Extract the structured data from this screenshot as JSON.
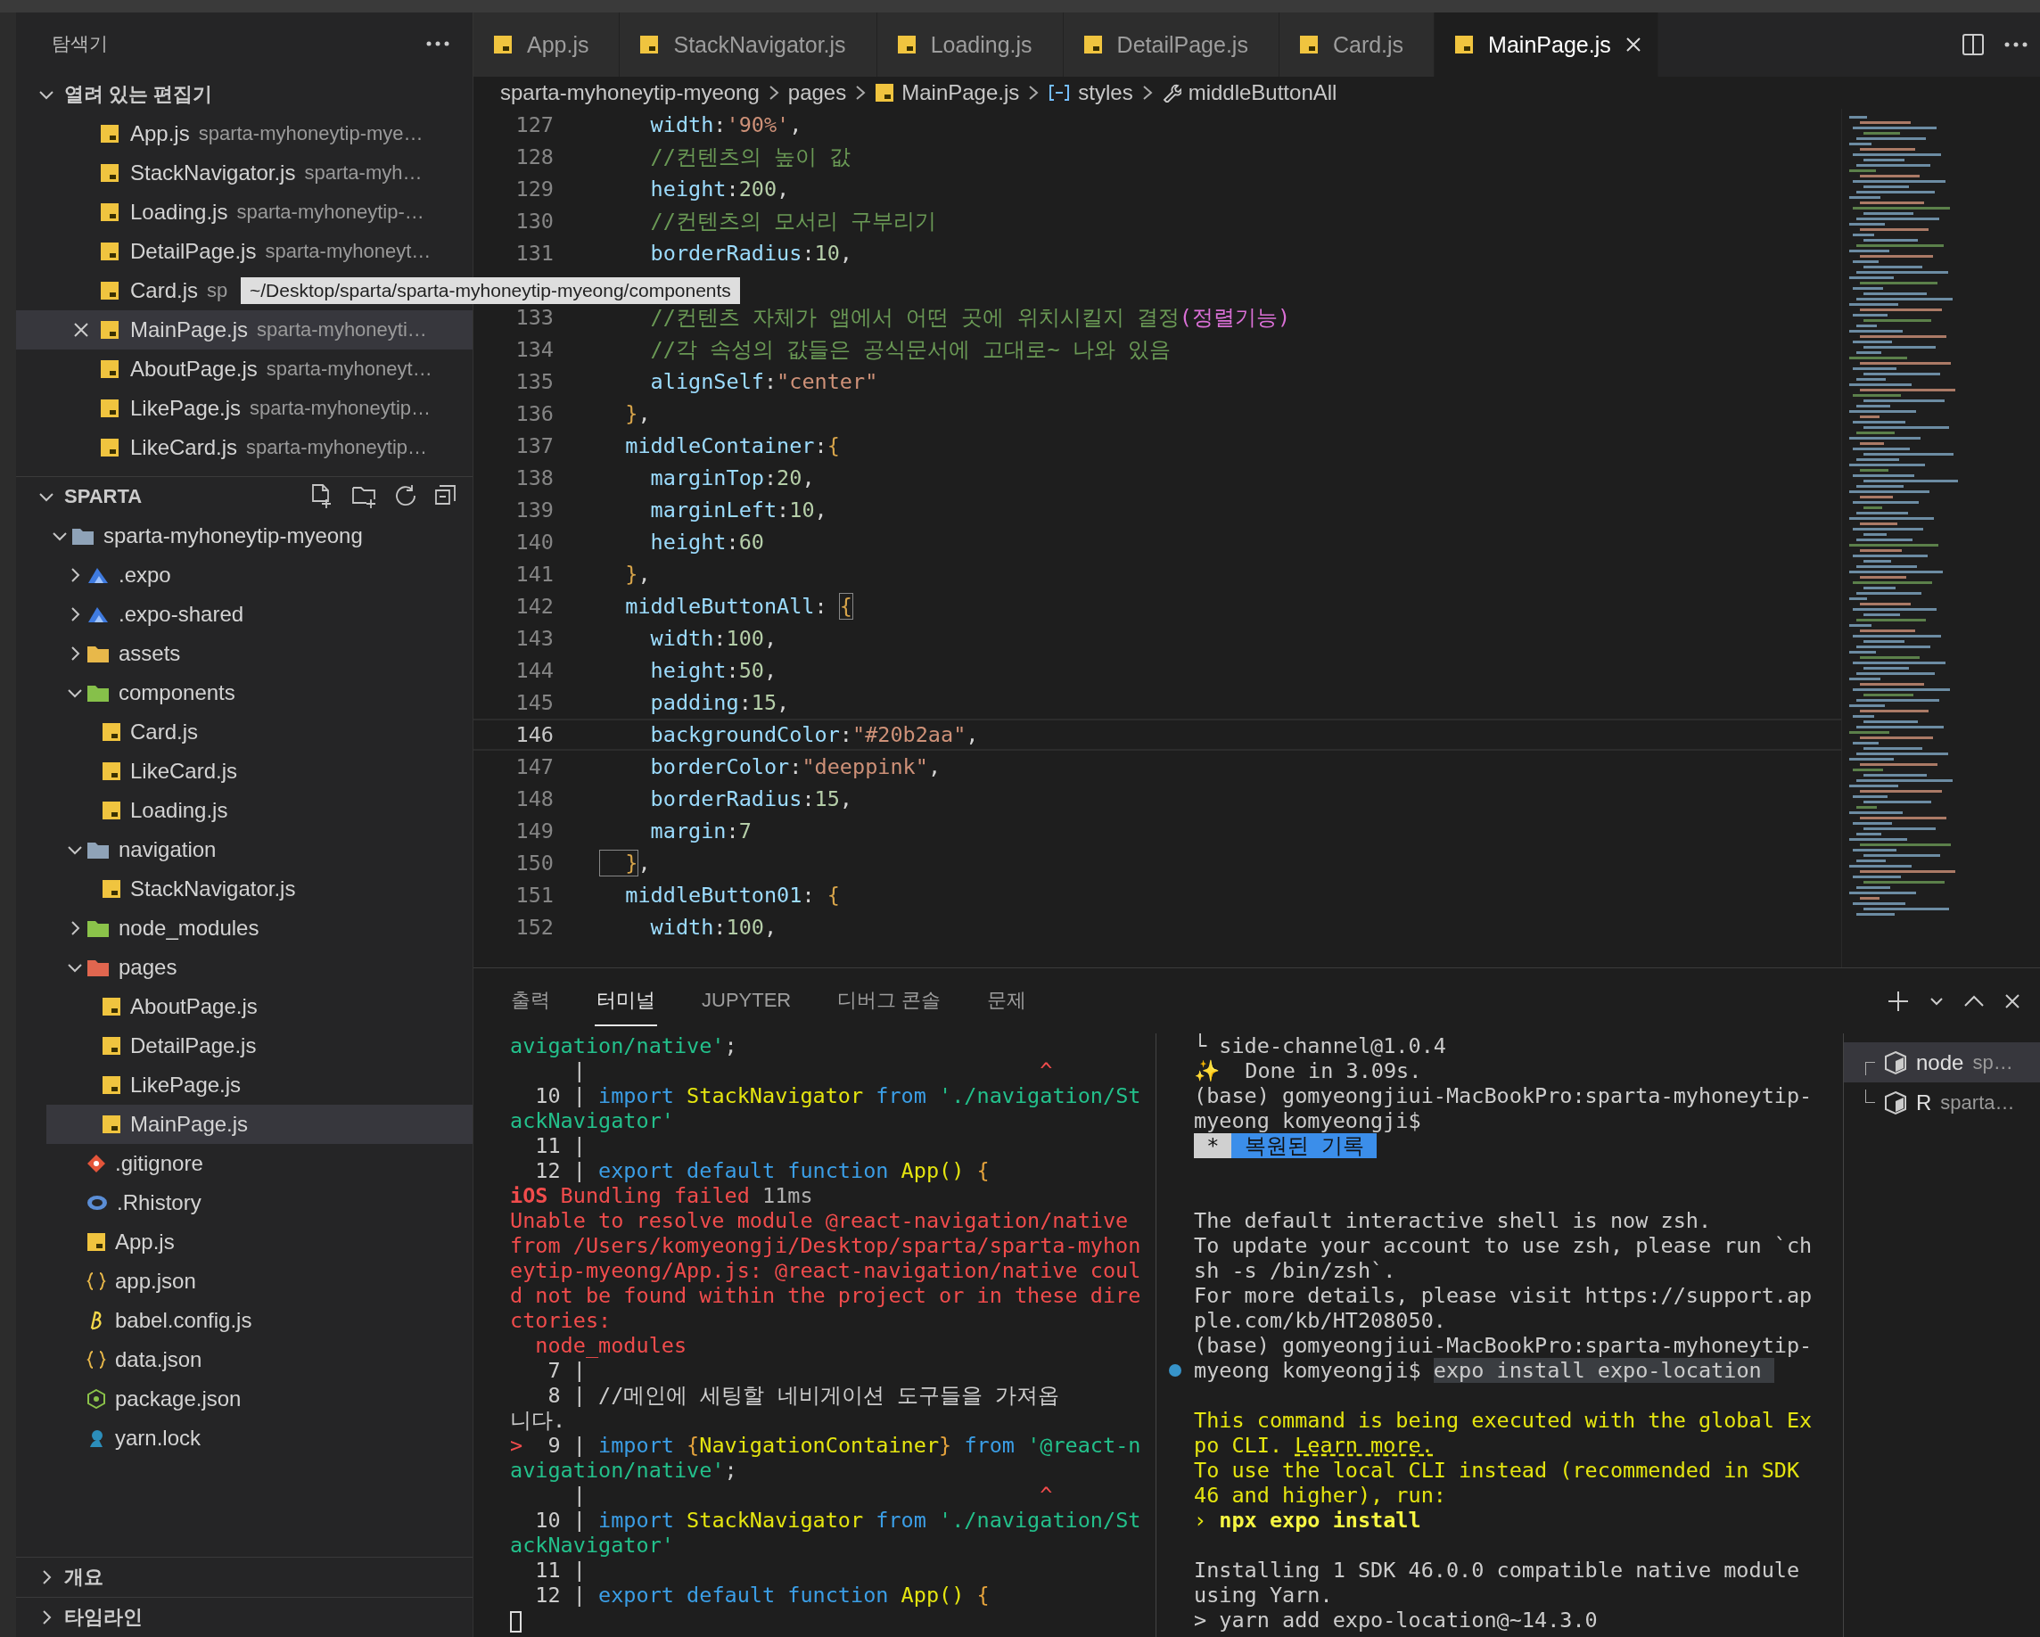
{
  "sidebar": {
    "title": "탐색기",
    "open_editors": {
      "title": "열려 있는 편집기",
      "items": [
        {
          "name": "App.js",
          "description": "sparta-myhoneytip-mye…",
          "selected": false
        },
        {
          "name": "StackNavigator.js",
          "description": "sparta-myh…",
          "selected": false
        },
        {
          "name": "Loading.js",
          "description": "sparta-myhoneytip-…",
          "selected": false
        },
        {
          "name": "DetailPage.js",
          "description": "sparta-myhoneyt…",
          "selected": false
        },
        {
          "name": "Card.js",
          "description": "sp",
          "selected": false
        },
        {
          "name": "MainPage.js",
          "description": "sparta-myhoneyti…",
          "selected": true
        },
        {
          "name": "AboutPage.js",
          "description": "sparta-myhoneyt…",
          "selected": false
        },
        {
          "name": "LikePage.js",
          "description": "sparta-myhoneytip…",
          "selected": false
        },
        {
          "name": "LikeCard.js",
          "description": "sparta-myhoneytip…",
          "selected": false
        }
      ]
    },
    "tree": {
      "title": "SPARTA",
      "items": [
        {
          "label": "sparta-myhoneytip-myeong",
          "kind": "folder",
          "expanded": true,
          "selected": false,
          "children": [
            {
              "label": ".expo",
              "kind": "folder-expo",
              "expanded": false,
              "selected": false
            },
            {
              "label": ".expo-shared",
              "kind": "folder-expo",
              "expanded": false,
              "selected": false
            },
            {
              "label": "assets",
              "kind": "folder-assets",
              "expanded": false,
              "selected": false
            },
            {
              "label": "components",
              "kind": "folder-components",
              "expanded": true,
              "selected": false,
              "children": [
                {
                  "label": "Card.js",
                  "kind": "js",
                  "selected": false
                },
                {
                  "label": "LikeCard.js",
                  "kind": "js",
                  "selected": false
                },
                {
                  "label": "Loading.js",
                  "kind": "js",
                  "selected": false
                }
              ]
            },
            {
              "label": "navigation",
              "kind": "folder",
              "expanded": true,
              "selected": false,
              "children": [
                {
                  "label": "StackNavigator.js",
                  "kind": "js",
                  "selected": false
                }
              ]
            },
            {
              "label": "node_modules",
              "kind": "folder-node",
              "expanded": false,
              "selected": false
            },
            {
              "label": "pages",
              "kind": "folder-pages",
              "expanded": true,
              "selected": false,
              "children": [
                {
                  "label": "AboutPage.js",
                  "kind": "js",
                  "selected": false
                },
                {
                  "label": "DetailPage.js",
                  "kind": "js",
                  "selected": false
                },
                {
                  "label": "LikePage.js",
                  "kind": "js",
                  "selected": false
                },
                {
                  "label": "MainPage.js",
                  "kind": "js",
                  "selected": true
                }
              ]
            },
            {
              "label": ".gitignore",
              "kind": "git",
              "selected": false
            },
            {
              "label": ".Rhistory",
              "kind": "r",
              "selected": false
            },
            {
              "label": "App.js",
              "kind": "js",
              "selected": false
            },
            {
              "label": "app.json",
              "kind": "json",
              "selected": false
            },
            {
              "label": "babel.config.js",
              "kind": "babel",
              "selected": false
            },
            {
              "label": "data.json",
              "kind": "json",
              "selected": false
            },
            {
              "label": "package.json",
              "kind": "npm",
              "selected": false
            },
            {
              "label": "yarn.lock",
              "kind": "yarn",
              "selected": false
            }
          ]
        }
      ]
    },
    "sections": [
      {
        "title": "개요",
        "expanded": false
      },
      {
        "title": "타임라인",
        "expanded": false
      }
    ]
  },
  "tooltip": "~/Desktop/sparta/sparta-myhoneytip-myeong/components",
  "tabs": [
    {
      "label": "App.js",
      "selected": false
    },
    {
      "label": "StackNavigator.js",
      "selected": false
    },
    {
      "label": "Loading.js",
      "selected": false
    },
    {
      "label": "DetailPage.js",
      "selected": false
    },
    {
      "label": "Card.js",
      "selected": false
    },
    {
      "label": "MainPage.js",
      "selected": true
    }
  ],
  "breadcrumb": [
    {
      "kind": "folder",
      "label": "sparta-myhoneytip-myeong"
    },
    {
      "kind": "folder",
      "label": "pages"
    },
    {
      "kind": "file",
      "label": "MainPage.js"
    },
    {
      "kind": "symbol",
      "label": "styles"
    },
    {
      "kind": "property",
      "label": "middleButtonAll"
    }
  ],
  "editor": {
    "lines": [
      {
        "kind": "code",
        "n": "127",
        "current": false,
        "tokens": [
          {
            "kind": "p",
            "text": "    width"
          },
          {
            "kind": "o",
            "text": ":"
          },
          {
            "kind": "s",
            "text": "'90%'"
          },
          {
            "kind": "o",
            "text": ","
          }
        ]
      },
      {
        "kind": "code",
        "n": "128",
        "current": false,
        "tokens": [
          {
            "kind": "c",
            "text": "    //컨텐츠의 높이 값"
          }
        ]
      },
      {
        "kind": "code",
        "n": "129",
        "current": false,
        "tokens": [
          {
            "kind": "p",
            "text": "    height"
          },
          {
            "kind": "o",
            "text": ":"
          },
          {
            "kind": "n",
            "text": "200"
          },
          {
            "kind": "o",
            "text": ","
          }
        ]
      },
      {
        "kind": "code",
        "n": "130",
        "current": false,
        "tokens": [
          {
            "kind": "c",
            "text": "    //컨텐츠의 모서리 구부리기"
          }
        ]
      },
      {
        "kind": "code",
        "n": "131",
        "current": false,
        "tokens": [
          {
            "kind": "p",
            "text": "    borderRadius"
          },
          {
            "kind": "o",
            "text": ":"
          },
          {
            "kind": "n",
            "text": "10"
          },
          {
            "kind": "o",
            "text": ","
          }
        ]
      },
      {
        "kind": "covered"
      },
      {
        "kind": "code",
        "n": "133",
        "current": false,
        "tokens": [
          {
            "kind": "c",
            "text": "    //컨텐츠 자체가 앱에서 어떤 곳에 위치시킬지 결정"
          },
          {
            "kind": "k",
            "text": "(정렬기능)"
          }
        ]
      },
      {
        "kind": "code",
        "n": "134",
        "current": false,
        "tokens": [
          {
            "kind": "c",
            "text": "    //각 속성의 값들은 공식문서에 고대로~ 나와 있음"
          }
        ]
      },
      {
        "kind": "code",
        "n": "135",
        "current": false,
        "tokens": [
          {
            "kind": "p",
            "text": "    alignSelf"
          },
          {
            "kind": "o",
            "text": ":"
          },
          {
            "kind": "s",
            "text": "\"center\""
          }
        ]
      },
      {
        "kind": "code",
        "n": "136",
        "current": false,
        "tokens": [
          {
            "kind": "b",
            "text": "  }"
          },
          {
            "kind": "o",
            "text": ","
          }
        ]
      },
      {
        "kind": "code",
        "n": "137",
        "current": false,
        "tokens": [
          {
            "kind": "p",
            "text": "  middleContainer"
          },
          {
            "kind": "o",
            "text": ":"
          },
          {
            "kind": "b",
            "text": "{"
          }
        ]
      },
      {
        "kind": "code",
        "n": "138",
        "current": false,
        "tokens": [
          {
            "kind": "p",
            "text": "    marginTop"
          },
          {
            "kind": "o",
            "text": ":"
          },
          {
            "kind": "n",
            "text": "20"
          },
          {
            "kind": "o",
            "text": ","
          }
        ]
      },
      {
        "kind": "code",
        "n": "139",
        "current": false,
        "tokens": [
          {
            "kind": "p",
            "text": "    marginLeft"
          },
          {
            "kind": "o",
            "text": ":"
          },
          {
            "kind": "n",
            "text": "10"
          },
          {
            "kind": "o",
            "text": ","
          }
        ]
      },
      {
        "kind": "code",
        "n": "140",
        "current": false,
        "tokens": [
          {
            "kind": "p",
            "text": "    height"
          },
          {
            "kind": "o",
            "text": ":"
          },
          {
            "kind": "n",
            "text": "60"
          }
        ]
      },
      {
        "kind": "code",
        "n": "141",
        "current": false,
        "tokens": [
          {
            "kind": "b",
            "text": "  }"
          },
          {
            "kind": "o",
            "text": ","
          }
        ]
      },
      {
        "kind": "code",
        "n": "142",
        "current": false,
        "tokens": [
          {
            "kind": "p",
            "text": "  middleButtonAll"
          },
          {
            "kind": "o",
            "text": ": "
          },
          {
            "kind": "m",
            "text": "{"
          }
        ]
      },
      {
        "kind": "code",
        "n": "143",
        "current": false,
        "tokens": [
          {
            "kind": "p",
            "text": "    width"
          },
          {
            "kind": "o",
            "text": ":"
          },
          {
            "kind": "n",
            "text": "100"
          },
          {
            "kind": "o",
            "text": ","
          }
        ]
      },
      {
        "kind": "code",
        "n": "144",
        "current": false,
        "tokens": [
          {
            "kind": "p",
            "text": "    height"
          },
          {
            "kind": "o",
            "text": ":"
          },
          {
            "kind": "n",
            "text": "50"
          },
          {
            "kind": "o",
            "text": ","
          }
        ]
      },
      {
        "kind": "code",
        "n": "145",
        "current": false,
        "tokens": [
          {
            "kind": "p",
            "text": "    padding"
          },
          {
            "kind": "o",
            "text": ":"
          },
          {
            "kind": "n",
            "text": "15"
          },
          {
            "kind": "o",
            "text": ","
          }
        ]
      },
      {
        "kind": "code",
        "n": "146",
        "current": true,
        "tokens": [
          {
            "kind": "p",
            "text": "    backgroundColor"
          },
          {
            "kind": "o",
            "text": ":"
          },
          {
            "kind": "s",
            "text": "\"#20b2aa\""
          },
          {
            "kind": "o",
            "text": ","
          }
        ]
      },
      {
        "kind": "code",
        "n": "147",
        "current": false,
        "tokens": [
          {
            "kind": "p",
            "text": "    borderColor"
          },
          {
            "kind": "o",
            "text": ":"
          },
          {
            "kind": "s",
            "text": "\"deeppink\""
          },
          {
            "kind": "o",
            "text": ","
          }
        ]
      },
      {
        "kind": "code",
        "n": "148",
        "current": false,
        "tokens": [
          {
            "kind": "p",
            "text": "    borderRadius"
          },
          {
            "kind": "o",
            "text": ":"
          },
          {
            "kind": "n",
            "text": "15"
          },
          {
            "kind": "o",
            "text": ","
          }
        ]
      },
      {
        "kind": "code",
        "n": "149",
        "current": false,
        "tokens": [
          {
            "kind": "p",
            "text": "    margin"
          },
          {
            "kind": "o",
            "text": ":"
          },
          {
            "kind": "n",
            "text": "7"
          }
        ]
      },
      {
        "kind": "code",
        "n": "150",
        "current": false,
        "tokens": [
          {
            "kind": "m",
            "text": "  }"
          },
          {
            "kind": "o",
            "text": ","
          }
        ]
      },
      {
        "kind": "code",
        "n": "151",
        "current": false,
        "tokens": [
          {
            "kind": "p",
            "text": "  middleButton01"
          },
          {
            "kind": "o",
            "text": ": "
          },
          {
            "kind": "b",
            "text": "{"
          }
        ]
      },
      {
        "kind": "code",
        "n": "152",
        "current": false,
        "tokens": [
          {
            "kind": "p",
            "text": "    width"
          },
          {
            "kind": "o",
            "text": ":"
          },
          {
            "kind": "n",
            "text": "100"
          },
          {
            "kind": "o",
            "text": ","
          }
        ]
      }
    ]
  },
  "panel": {
    "tabs": [
      {
        "label": "출력",
        "selected": false
      },
      {
        "label": "터미널",
        "selected": true
      },
      {
        "label": "JUPYTER",
        "selected": false
      },
      {
        "label": "디버그 콘솔",
        "selected": false
      },
      {
        "label": "문제",
        "selected": false
      }
    ],
    "terminal_left": [
      {
        "kind": "text",
        "tokens": [
          {
            "kind": "g",
            "text": "avigation/native'"
          },
          {
            "kind": "t",
            "text": ";"
          }
        ]
      },
      {
        "kind": "text",
        "tokens": [
          {
            "kind": "t",
            "text": "     |"
          },
          {
            "kind": "r",
            "text": "                                    ^"
          }
        ]
      },
      {
        "kind": "text",
        "tokens": [
          {
            "kind": "t",
            "text": "  10 | "
          },
          {
            "kind": "b",
            "text": "import "
          },
          {
            "kind": "y",
            "text": "StackNavigator "
          },
          {
            "kind": "b",
            "text": "from "
          },
          {
            "kind": "g",
            "text": "'./navigation/St"
          }
        ]
      },
      {
        "kind": "text",
        "tokens": [
          {
            "kind": "g",
            "text": "ackNavigator'"
          }
        ]
      },
      {
        "kind": "text",
        "tokens": [
          {
            "kind": "t",
            "text": "  11 |"
          }
        ]
      },
      {
        "kind": "text",
        "tokens": [
          {
            "kind": "t",
            "text": "  12 | "
          },
          {
            "kind": "b",
            "text": "export default function "
          },
          {
            "kind": "y",
            "text": "App()"
          },
          {
            "kind": "o",
            "text": " {"
          }
        ]
      },
      {
        "kind": "text",
        "tokens": [
          {
            "kind": "rb",
            "text": "iOS"
          },
          {
            "kind": "r",
            "text": " Bundling failed "
          },
          {
            "kind": "d",
            "text": "11ms"
          }
        ]
      },
      {
        "kind": "text",
        "tokens": [
          {
            "kind": "r",
            "text": "Unable to resolve module @react-navigation/native"
          }
        ]
      },
      {
        "kind": "text",
        "tokens": [
          {
            "kind": "r",
            "text": "from /Users/komyeongji/Desktop/sparta/sparta-myhon"
          }
        ]
      },
      {
        "kind": "text",
        "tokens": [
          {
            "kind": "r",
            "text": "eytip-myeong/App.js: @react-navigation/native coul"
          }
        ]
      },
      {
        "kind": "text",
        "tokens": [
          {
            "kind": "r",
            "text": "d not be found within the project or in these dire"
          }
        ]
      },
      {
        "kind": "text",
        "tokens": [
          {
            "kind": "r",
            "text": "ctories:"
          }
        ]
      },
      {
        "kind": "text",
        "tokens": [
          {
            "kind": "r",
            "text": "  node_modules"
          }
        ]
      },
      {
        "kind": "text",
        "tokens": [
          {
            "kind": "t",
            "text": "   7 |"
          }
        ]
      },
      {
        "kind": "text",
        "tokens": [
          {
            "kind": "t",
            "text": "   8 | //메인에 세팅할 네비게이션 도구들을 가져옵"
          }
        ]
      },
      {
        "kind": "text",
        "tokens": [
          {
            "kind": "t",
            "text": "니다."
          }
        ]
      },
      {
        "kind": "text",
        "tokens": [
          {
            "kind": "r",
            "text": "> "
          },
          {
            "kind": "t",
            "text": " 9 | "
          },
          {
            "kind": "b",
            "text": "import "
          },
          {
            "kind": "o",
            "text": "{"
          },
          {
            "kind": "y",
            "text": "NavigationContainer"
          },
          {
            "kind": "o",
            "text": "}"
          },
          {
            "kind": "b",
            "text": " from "
          },
          {
            "kind": "g",
            "text": "'@react-n"
          }
        ]
      },
      {
        "kind": "text",
        "tokens": [
          {
            "kind": "g",
            "text": "avigation/native'"
          },
          {
            "kind": "t",
            "text": ";"
          }
        ]
      },
      {
        "kind": "text",
        "tokens": [
          {
            "kind": "t",
            "text": "     |"
          },
          {
            "kind": "r",
            "text": "                                    ^"
          }
        ]
      },
      {
        "kind": "text",
        "tokens": [
          {
            "kind": "t",
            "text": "  10 | "
          },
          {
            "kind": "b",
            "text": "import "
          },
          {
            "kind": "y",
            "text": "StackNavigator "
          },
          {
            "kind": "b",
            "text": "from "
          },
          {
            "kind": "g",
            "text": "'./navigation/St"
          }
        ]
      },
      {
        "kind": "text",
        "tokens": [
          {
            "kind": "g",
            "text": "ackNavigator'"
          }
        ]
      },
      {
        "kind": "text",
        "tokens": [
          {
            "kind": "t",
            "text": "  11 |"
          }
        ]
      },
      {
        "kind": "text",
        "tokens": [
          {
            "kind": "t",
            "text": "  12 | "
          },
          {
            "kind": "b",
            "text": "export default function "
          },
          {
            "kind": "y",
            "text": "App()"
          },
          {
            "kind": "o",
            "text": " {"
          }
        ]
      },
      {
        "kind": "cursor"
      }
    ],
    "terminal_right": [
      {
        "kind": "text",
        "tokens": [
          {
            "kind": "t",
            "text": "└ side-channel@1.0.4"
          }
        ]
      },
      {
        "kind": "text",
        "tokens": [
          {
            "kind": "y",
            "text": "✨"
          },
          {
            "kind": "t",
            "text": "  Done in 3.09s."
          }
        ]
      },
      {
        "kind": "text",
        "tokens": [
          {
            "kind": "t",
            "text": "(base) gomyeongjiui-MacBookPro:sparta-myhoneytip-"
          }
        ]
      },
      {
        "kind": "text",
        "tokens": [
          {
            "kind": "t",
            "text": "myeong komyeongji$"
          }
        ]
      },
      {
        "kind": "badge",
        "tokens": [
          {
            "kind": "star",
            "text": " * "
          },
          {
            "kind": "blue",
            "text": " 복원된 기록 "
          }
        ]
      },
      {
        "kind": "blank"
      },
      {
        "kind": "blank"
      },
      {
        "kind": "text",
        "tokens": [
          {
            "kind": "t",
            "text": "The default interactive shell is now zsh."
          }
        ]
      },
      {
        "kind": "text",
        "tokens": [
          {
            "kind": "t",
            "text": "To update your account to use zsh, please run `ch"
          }
        ]
      },
      {
        "kind": "text",
        "tokens": [
          {
            "kind": "t",
            "text": "sh -s /bin/zsh`."
          }
        ]
      },
      {
        "kind": "text",
        "tokens": [
          {
            "kind": "t",
            "text": "For more details, please visit https://support.ap"
          }
        ]
      },
      {
        "kind": "text",
        "tokens": [
          {
            "kind": "t",
            "text": "ple.com/kb/HT208050."
          }
        ]
      },
      {
        "kind": "text",
        "tokens": [
          {
            "kind": "t",
            "text": "(base) gomyeongjiui-MacBookPro:sparta-myhoneytip-"
          }
        ]
      },
      {
        "kind": "marked",
        "tokens": [
          {
            "kind": "t",
            "text": "myeong komyeongji$ "
          },
          {
            "kind": "hl",
            "text": "expo install expo-location "
          }
        ]
      },
      {
        "kind": "blank"
      },
      {
        "kind": "text",
        "tokens": [
          {
            "kind": "y",
            "text": "This command is being executed with the global Ex"
          }
        ]
      },
      {
        "kind": "text",
        "tokens": [
          {
            "kind": "y",
            "text": "po CLI. "
          },
          {
            "kind": "link",
            "text": "Learn more."
          }
        ]
      },
      {
        "kind": "text",
        "tokens": [
          {
            "kind": "y",
            "text": "To use the local CLI instead (recommended in SDK"
          }
        ]
      },
      {
        "kind": "text",
        "tokens": [
          {
            "kind": "y",
            "text": "46 and higher), run:"
          }
        ]
      },
      {
        "kind": "text",
        "tokens": [
          {
            "kind": "y",
            "text": "› "
          },
          {
            "kind": "yb",
            "text": "npx expo install"
          }
        ]
      },
      {
        "kind": "blank"
      },
      {
        "kind": "text",
        "tokens": [
          {
            "kind": "t",
            "text": "Installing 1 SDK 46.0.0 compatible native module"
          }
        ]
      },
      {
        "kind": "text",
        "tokens": [
          {
            "kind": "t",
            "text": "using Yarn."
          }
        ]
      },
      {
        "kind": "text",
        "tokens": [
          {
            "kind": "t",
            "text": "> yarn add expo-location@~14.3.0"
          }
        ]
      }
    ],
    "terminals": [
      {
        "label": "node",
        "description": "sp…",
        "selected": true
      },
      {
        "label": "R",
        "description": "sparta…",
        "selected": false
      }
    ]
  }
}
